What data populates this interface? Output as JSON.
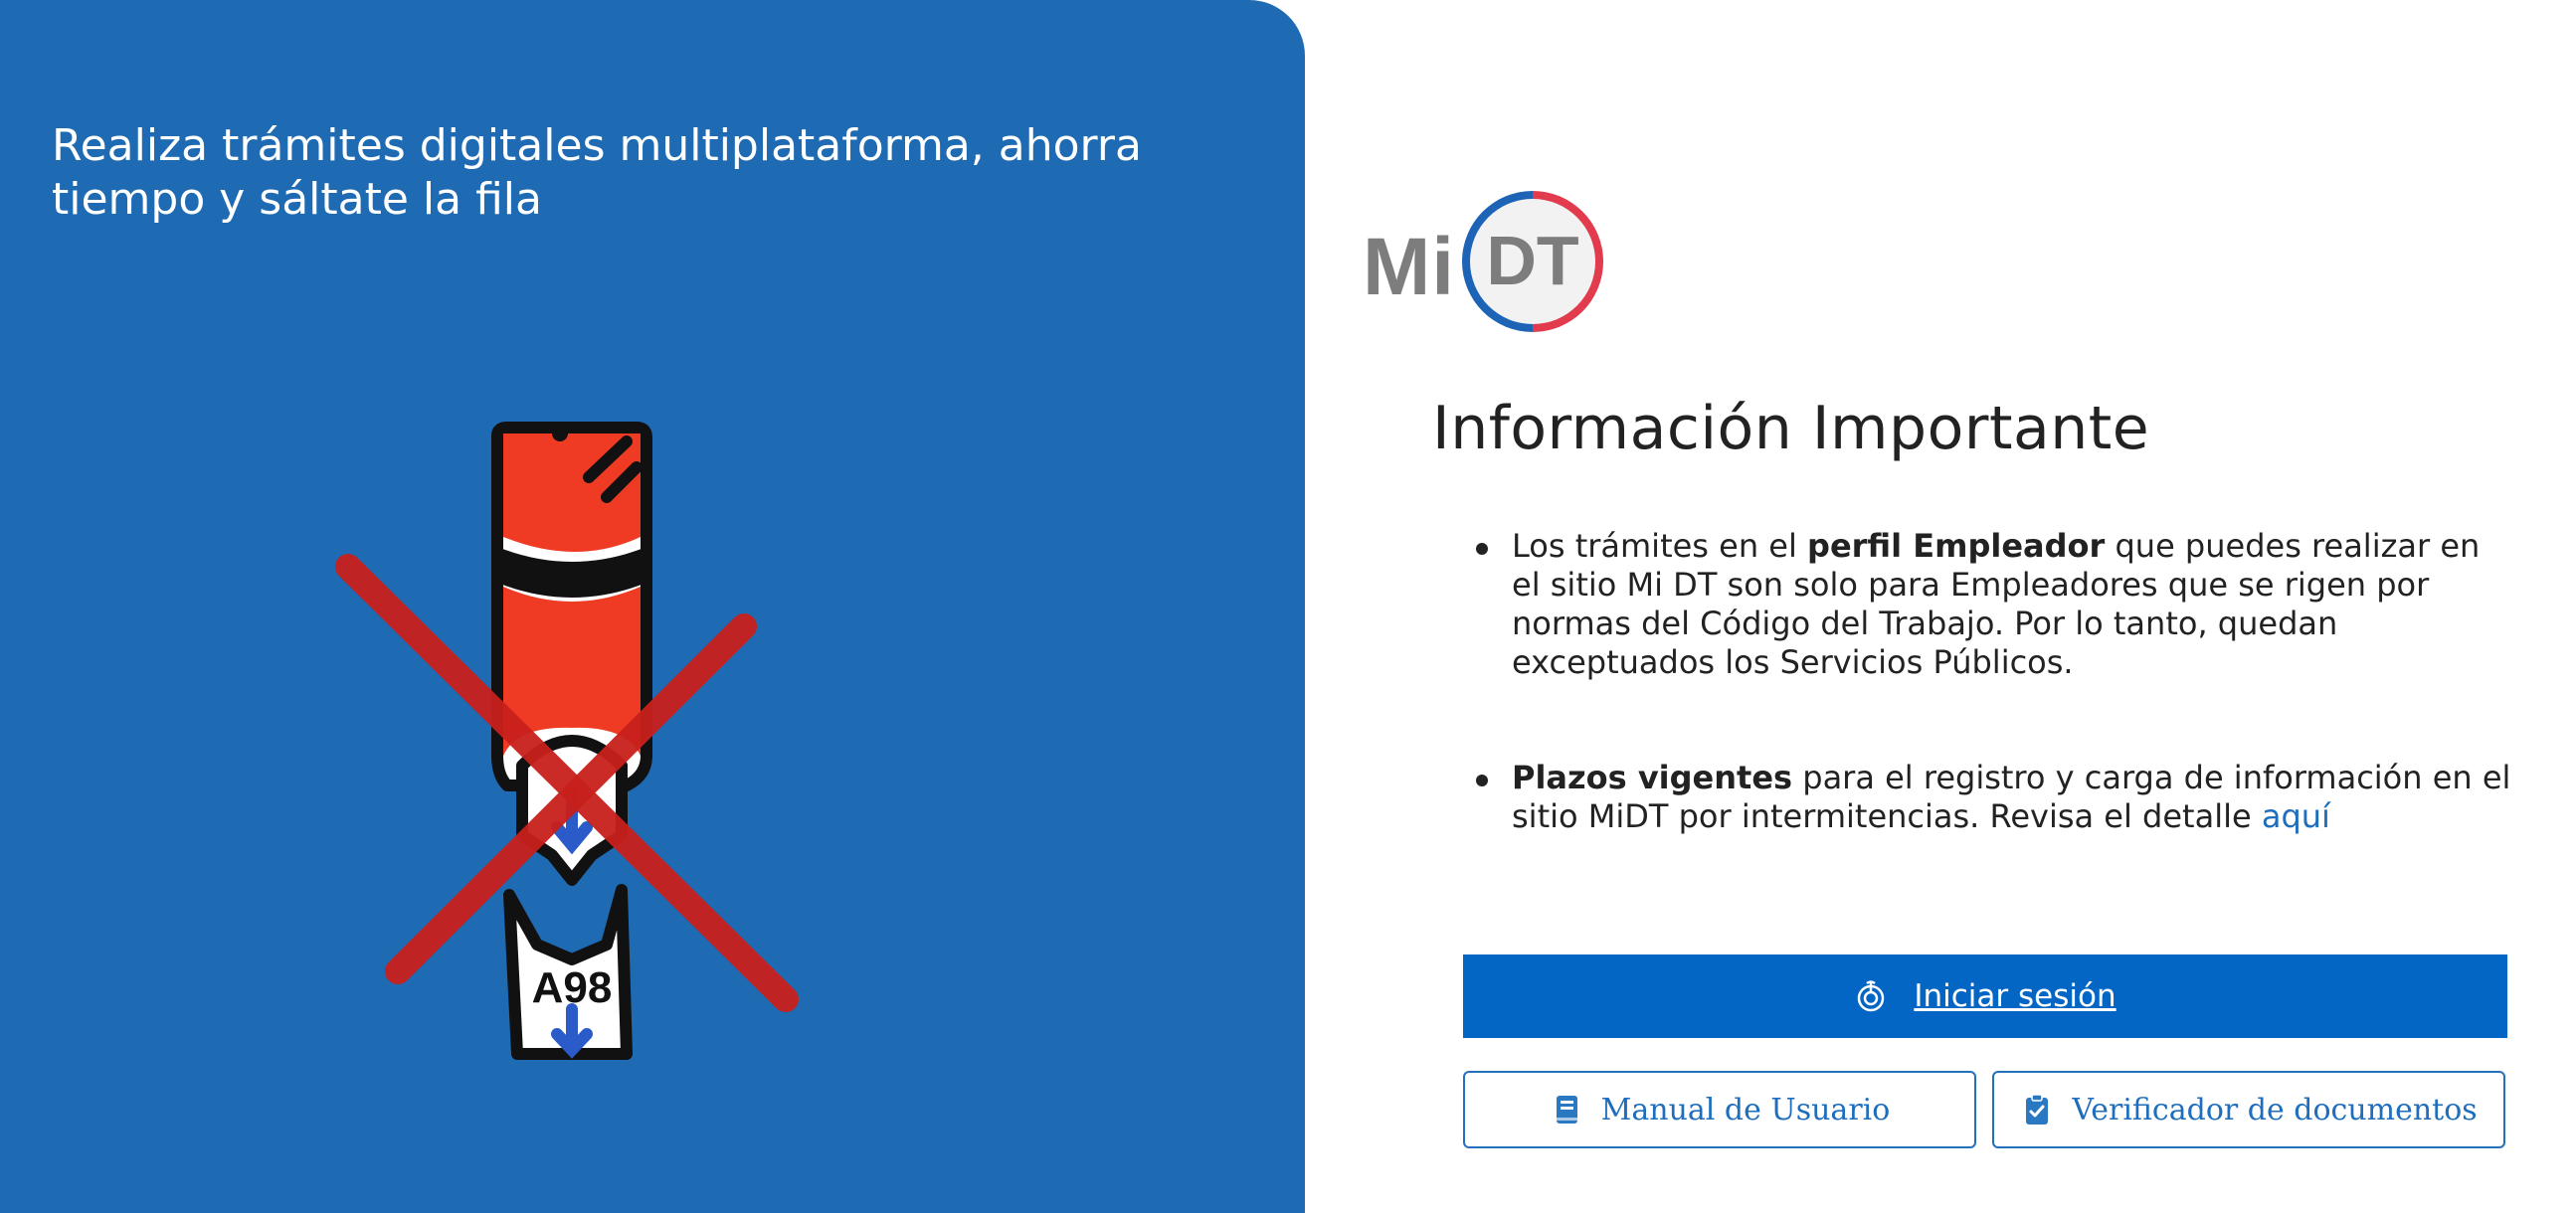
{
  "hero": {
    "headline": "Realiza trámites digitales multiplataforma, ahorra tiempo y sáltate la fila",
    "ticket_label": "A98",
    "colors": {
      "background": "#1e6bb4",
      "cross": "#c8201c",
      "ticket_top": "#f03b24"
    }
  },
  "logo": {
    "mi": "Mi",
    "dt": "DT"
  },
  "info": {
    "title": "Información Importante",
    "item1": {
      "pre": "Los trámites en el ",
      "bold": "perfil Empleador",
      "post": " que puedes realizar en el sitio Mi DT son solo para Empleadores que se rigen por normas del Código del Trabajo. Por lo tanto, quedan exceptuados los Servicios Públicos."
    },
    "item2": {
      "bold": "Plazos vigentes",
      "post": " para el registro y carga de información en el sitio MiDT por intermitencias. Revisa el detalle ",
      "link": "aquí"
    }
  },
  "buttons": {
    "login": "Iniciar sesión",
    "manual": "Manual de Usuario",
    "verifier": "Verificador de documentos"
  },
  "icons": {
    "login": "fingerprint-icon",
    "manual": "book-icon",
    "verifier": "clipboard-check-icon"
  },
  "colors": {
    "primary": "#0366c4",
    "link": "#1f6ebd",
    "text": "#222222"
  }
}
